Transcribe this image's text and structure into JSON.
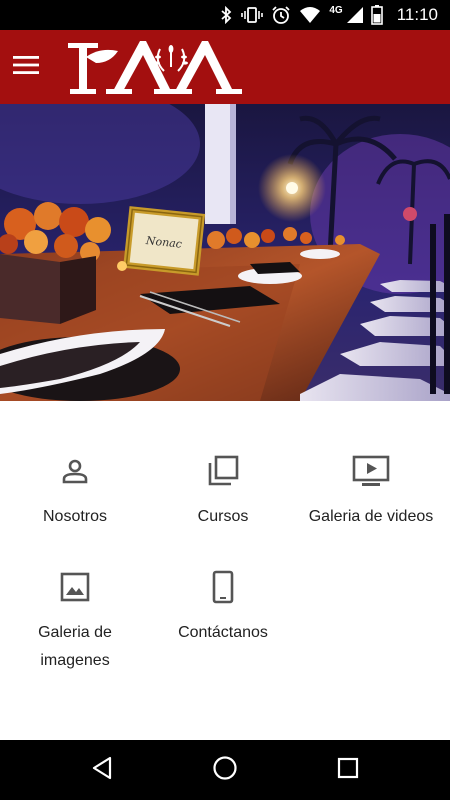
{
  "status_bar": {
    "time": "11:10",
    "network": "4G",
    "icons": [
      "bluetooth-icon",
      "vibrate-icon",
      "alarm-icon",
      "wifi-icon",
      "signal-icon",
      "battery-icon"
    ]
  },
  "app_bar": {
    "menu_icon": "hamburger-menu-icon",
    "logo_text": "IAA",
    "background": "#a30f0f"
  },
  "hero": {
    "sign_text": "Nonac"
  },
  "tiles": [
    {
      "label": "Nosotros",
      "icon": "person-icon"
    },
    {
      "label": "Cursos",
      "icon": "library-icon"
    },
    {
      "label": "Galeria de videos",
      "icon": "video-player-icon"
    },
    {
      "label": "Galeria de imagenes",
      "icon": "image-icon"
    },
    {
      "label": "Contáctanos",
      "icon": "phone-icon"
    }
  ],
  "nav_bar": {
    "icons": [
      "back-icon",
      "home-icon",
      "recents-icon"
    ]
  }
}
